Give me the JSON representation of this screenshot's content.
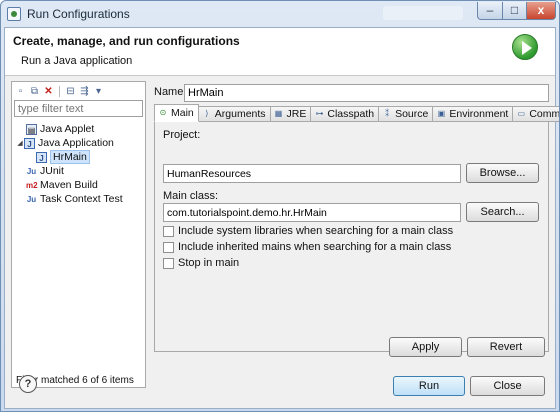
{
  "window": {
    "title": "Run Configurations",
    "close_glyph": "x"
  },
  "header": {
    "title": "Create, manage, and run configurations",
    "subtitle": "Run a Java application",
    "badge_icon": "run-icon"
  },
  "left_panel": {
    "toolbar": [
      "new-configuration-icon",
      "duplicate-icon",
      "delete-icon",
      "collapse-all-icon",
      "filter-icon",
      "dropdown-icon"
    ],
    "filter_placeholder": "type filter text",
    "tree": [
      {
        "label": "Java Applet",
        "icon": "java-applet-icon",
        "level": 1
      },
      {
        "label": "Java Application",
        "icon": "java-application-icon",
        "level": 1,
        "expanded": true
      },
      {
        "label": "HrMain",
        "icon": "java-application-icon",
        "level": 2,
        "selected": true
      },
      {
        "label": "JUnit",
        "icon": "junit-icon",
        "level": 1
      },
      {
        "label": "Maven Build",
        "icon": "maven-icon",
        "level": 1
      },
      {
        "label": "Task Context Test",
        "icon": "junit-icon",
        "level": 1
      }
    ],
    "filter_status": "Filter matched 6 of 6 items",
    "icon_glyphs": {
      "junit": "Ju",
      "maven": "m2",
      "java_app": "J",
      "applet": "▤"
    }
  },
  "config": {
    "name_label": "Name:",
    "name_value": "HrMain",
    "tabs": [
      {
        "label": "Main",
        "icon": "main-tab-icon",
        "glyph": "⊙",
        "active": true
      },
      {
        "label": "Arguments",
        "icon": "arguments-tab-icon",
        "glyph": "⟩"
      },
      {
        "label": "JRE",
        "icon": "jre-tab-icon",
        "glyph": "▦"
      },
      {
        "label": "Classpath",
        "icon": "classpath-tab-icon",
        "glyph": "⊶"
      },
      {
        "label": "Source",
        "icon": "source-tab-icon",
        "glyph": "⁑"
      },
      {
        "label": "Environment",
        "icon": "environment-tab-icon",
        "glyph": "▣"
      },
      {
        "label": "Common",
        "icon": "common-tab-icon",
        "glyph": "▭"
      }
    ],
    "main": {
      "project_label": "Project:",
      "project_value": "HumanResources",
      "browse_button": "Browse...",
      "main_class_label": "Main class:",
      "main_class_value": "com.tutorialspoint.demo.hr.HrMain",
      "search_button": "Search...",
      "checkboxes": [
        {
          "label": "Include system libraries when searching for a main class",
          "checked": false
        },
        {
          "label": "Include inherited mains when searching for a main class",
          "checked": false
        },
        {
          "label": "Stop in main",
          "checked": false
        }
      ]
    },
    "apply_button": "Apply",
    "revert_button": "Revert"
  },
  "footer": {
    "help_glyph": "?",
    "run_button": "Run",
    "close_button": "Close"
  }
}
